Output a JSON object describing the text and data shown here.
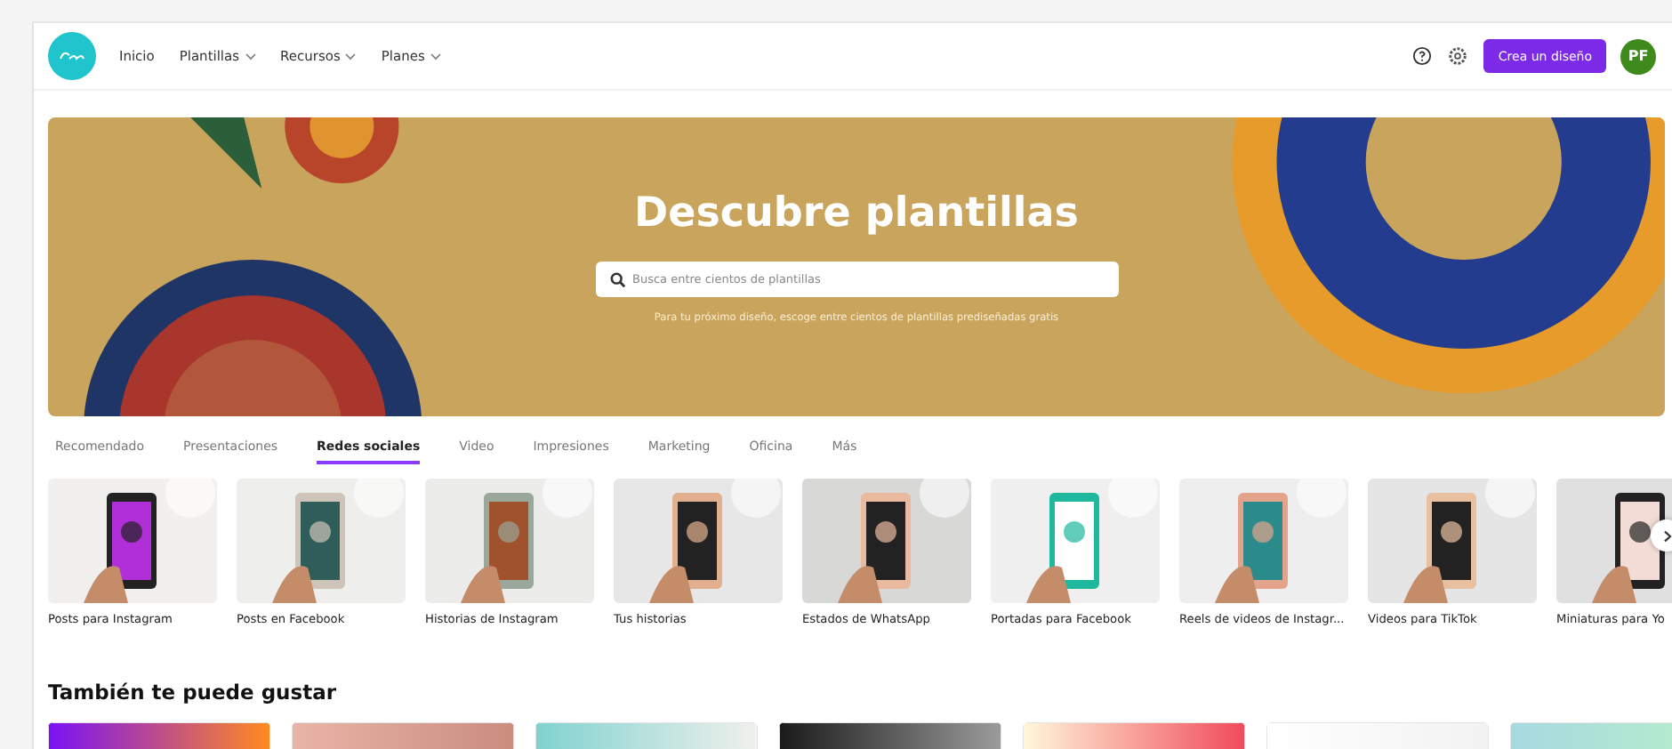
{
  "header": {
    "nav": [
      {
        "label": "Inicio",
        "dropdown": false
      },
      {
        "label": "Plantillas",
        "dropdown": true
      },
      {
        "label": "Recursos",
        "dropdown": true
      },
      {
        "label": "Planes",
        "dropdown": true
      }
    ],
    "cta": "Crea un diseño",
    "avatar": "PF"
  },
  "hero": {
    "title": "Descubre plantillas",
    "search": {
      "placeholder": "Busca entre cientos de plantillas"
    },
    "caption": "Para tu próximo diseño, escoge entre cientos de plantillas prediseñadas gratis"
  },
  "tabs": [
    {
      "label": "Recomendado",
      "selected": false
    },
    {
      "label": "Presentaciones",
      "selected": false
    },
    {
      "label": "Redes sociales",
      "selected": true
    },
    {
      "label": "Video",
      "selected": false
    },
    {
      "label": "Impresiones",
      "selected": false
    },
    {
      "label": "Marketing",
      "selected": false
    },
    {
      "label": "Oficina",
      "selected": false
    },
    {
      "label": "Más",
      "selected": false
    }
  ],
  "templates": [
    {
      "label": "Posts para Instagram"
    },
    {
      "label": "Posts en Facebook"
    },
    {
      "label": "Historias de Instagram"
    },
    {
      "label": "Tus historias"
    },
    {
      "label": "Estados de WhatsApp"
    },
    {
      "label": "Portadas para Facebook"
    },
    {
      "label": "Reels de videos de Instagr..."
    },
    {
      "label": "Videos para TikTok"
    },
    {
      "label": "Miniaturas para Yo"
    }
  ],
  "suggestions": {
    "title": "También te puede gustar"
  }
}
